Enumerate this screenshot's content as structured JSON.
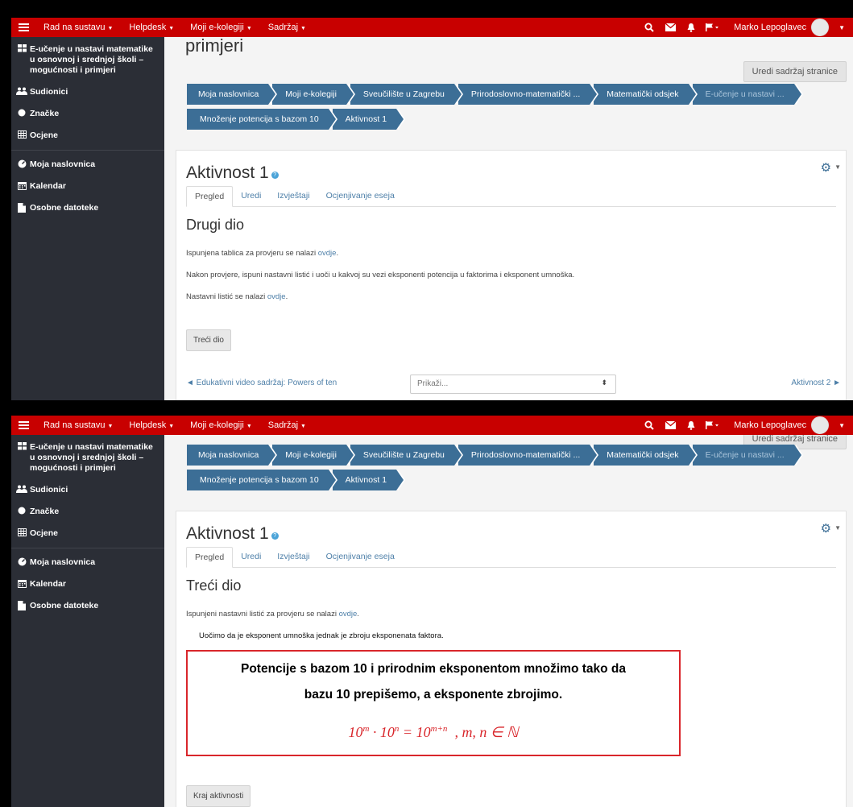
{
  "navbar": {
    "menu": [
      "Rad na sustavu",
      "Helpdesk",
      "Moji e-kolegiji",
      "Sadržaj"
    ],
    "user_name": "Marko Lepoglavec",
    "icons": [
      "search-icon",
      "envelope-icon",
      "bell-icon",
      "flag-icon"
    ]
  },
  "sidebar": {
    "course": "E-učenje u nastavi matematike u osnovnoj i srednjoj školi – mogućnosti i primjeri",
    "participants": "Sudionici",
    "badges": "Značke",
    "grades": "Ocjene",
    "home": "Moja naslovnica",
    "calendar": "Kalendar",
    "files": "Osobne datoteke"
  },
  "page": {
    "title_fragment": "primjeri",
    "edit_button": "Uredi sadržaj stranice"
  },
  "breadcrumb": {
    "row1": [
      "Moja naslovnica",
      "Moji e-kolegiji",
      "Sveučilište u Zagrebu",
      "Prirodoslovno-matematički ...",
      "Matematički odsjek",
      "E-učenje u nastavi ..."
    ],
    "row2": [
      "Množenje potencija s bazom 10",
      "Aktivnost 1"
    ]
  },
  "activity": {
    "title": "Aktivnost 1",
    "tabs": [
      "Pregled",
      "Uredi",
      "Izvještaji",
      "Ocjenjivanje eseja"
    ]
  },
  "screen1": {
    "section_title": "Drugi dio",
    "p1_text": "Ispunjena tablica za provjeru se nalazi",
    "p1_link": "ovdje",
    "p2_text": "Nakon provjere, ispuni nastavni listić i uoči u kakvoj su vezi eksponenti potencija u faktorima i eksponent umnoška.",
    "p3_text": "Nastavni listić se nalazi",
    "p3_link": "ovdje",
    "button": "Treći dio",
    "prev_link": "◄ Edukativni video sadržaj: Powers of ten",
    "jump_placeholder": "Prikaži...",
    "next_link": "Aktivnost 2 ►"
  },
  "screen2": {
    "section_title": "Treći dio",
    "p1_text": "Ispunjeni nastavni listić za provjeru se nalazi",
    "p1_link": "ovdje",
    "observation": "Uočimo da je eksponent umnoška jednak je zbroju eksponenata faktora.",
    "rule_line1": "Potencije s bazom 10 i prirodnim eksponentom množimo tako da",
    "rule_line2": "bazu 10 prepišemo, a eksponente zbrojimo.",
    "formula": {
      "a_base": "10",
      "a_exp": "m",
      "dot": " · ",
      "b_base": "10",
      "b_exp": "n",
      "eq": " = ",
      "c_base": "10",
      "c_exp": "m+n",
      "cond": "  , m, n ∈ ℕ"
    },
    "button": "Kraj aktivnosti"
  },
  "colors": {
    "navbar": "#c80000",
    "sidebar": "#2b2e36",
    "breadcrumb": "#3c6e96",
    "rule_border": "#d9262b",
    "link": "#4d7fa8"
  }
}
